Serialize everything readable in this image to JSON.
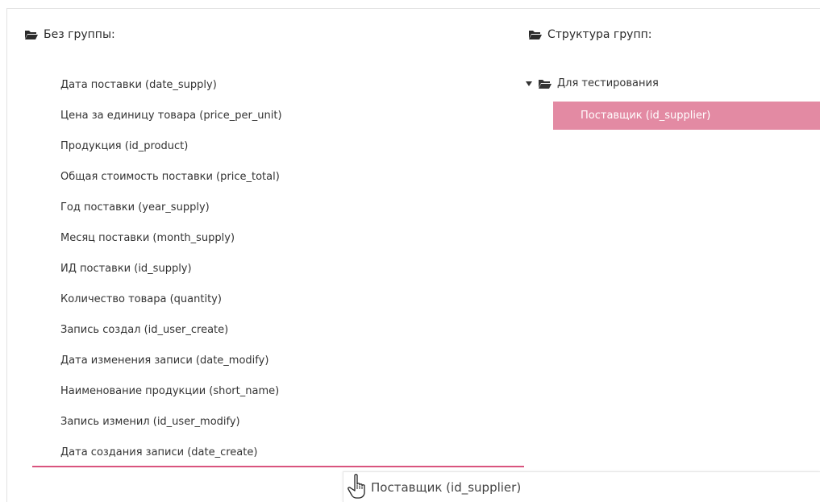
{
  "left_panel": {
    "heading": "Без группы:",
    "fields": [
      "Дата поставки (date_supply)",
      "Цена за единицу товара (price_per_unit)",
      "Продукция (id_product)",
      "Общая стоимость поставки (price_total)",
      "Год поставки (year_supply)",
      "Месяц поставки (month_supply)",
      "ИД поставки (id_supply)",
      "Количество товара (quantity)",
      "Запись создал (id_user_create)",
      "Дата изменения записи (date_modify)",
      "Наименование продукции (short_name)",
      "Запись изменил (id_user_modify)",
      "Дата создания записи (date_create)"
    ]
  },
  "right_panel": {
    "heading": "Структура групп:",
    "group": {
      "label": "Для тестирования",
      "children": [
        "Поставщик (id_supplier)"
      ]
    }
  },
  "drag_ghost": {
    "label": "Поставщик (id_supplier)"
  },
  "colors": {
    "accent": "#d9547e",
    "selected_bg": "#e38aa3"
  },
  "icons": {
    "folder": "folder-open-icon",
    "caret": "caret-down-icon",
    "cursor": "hand-pointer-icon"
  }
}
